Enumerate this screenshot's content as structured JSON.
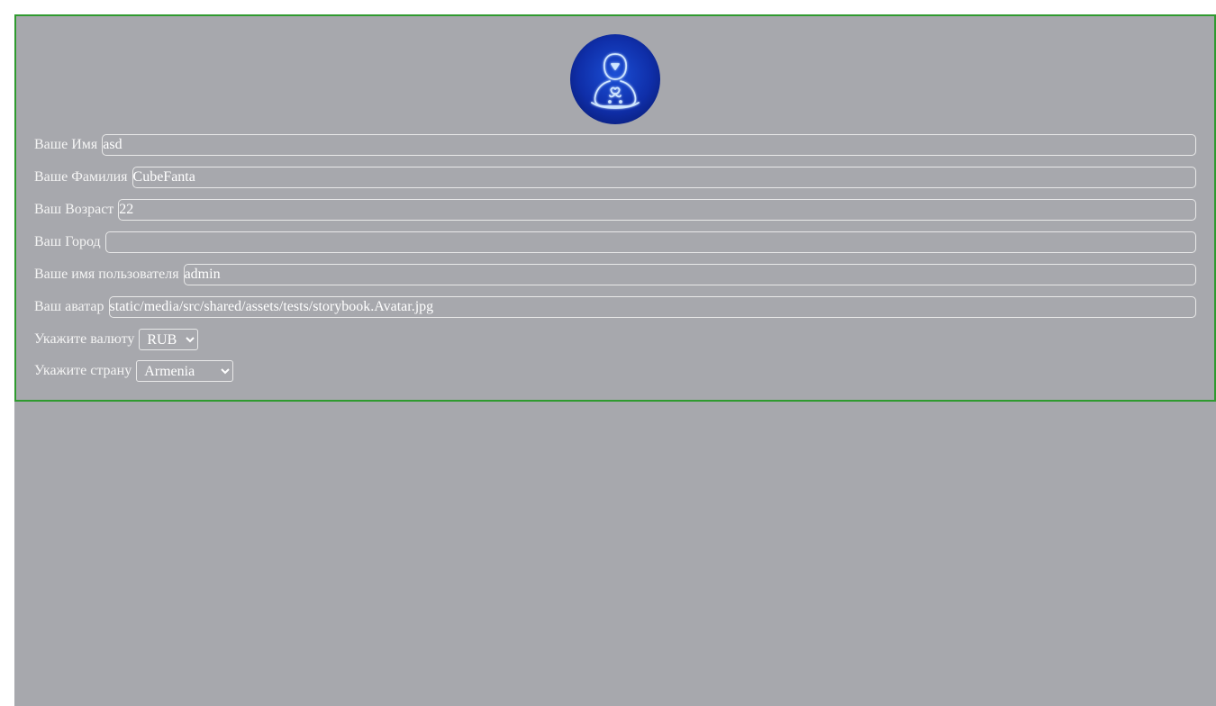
{
  "profile": {
    "avatar_alt": "avatar",
    "fields": {
      "first_name": {
        "label": "Ваше Имя",
        "value": "asd"
      },
      "last_name": {
        "label": "Ваше Фамилия",
        "value": "CubeFanta"
      },
      "age": {
        "label": "Ваш Возраст",
        "value": "22"
      },
      "city": {
        "label": "Ваш Город",
        "value": ""
      },
      "username": {
        "label": "Ваше имя пользователя",
        "value": "admin"
      },
      "avatar": {
        "label": "Ваш аватар",
        "value": "static/media/src/shared/assets/tests/storybook.Avatar.jpg"
      }
    },
    "currency": {
      "label": "Укажите валюту",
      "selected": "RUB"
    },
    "country": {
      "label": "Укажите страну",
      "selected": "Armenia"
    }
  },
  "colors": {
    "background": "#a7a8ad",
    "border": "#2f9a2f",
    "text": "#f4f4f4"
  }
}
